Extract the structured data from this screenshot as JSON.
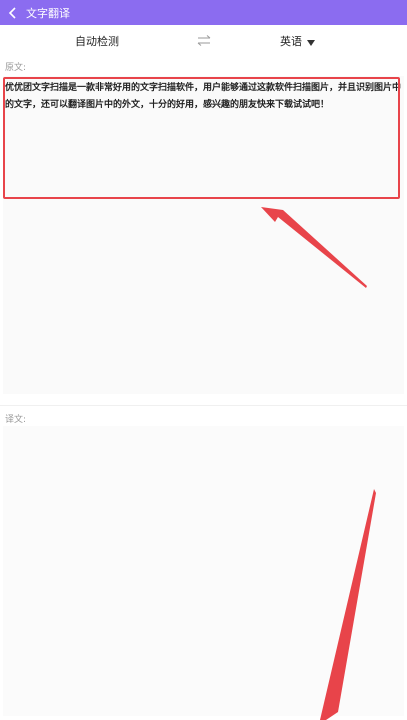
{
  "header": {
    "title": "文字翻译",
    "background_color": "#8b6cf0"
  },
  "language_bar": {
    "source_language": "自动检测",
    "target_language": "英语"
  },
  "source": {
    "label": "原文:",
    "text": "优优团文字扫描是一款非常好用的文字扫描软件，用户能够通过这款软件扫描图片，并且识别图片中的文字，还可以翻译图片中的外文，十分的好用，感兴趣的朋友快来下载试试吧！"
  },
  "result": {
    "label": "译文:",
    "text": ""
  },
  "annotation_color": "#e8444a"
}
